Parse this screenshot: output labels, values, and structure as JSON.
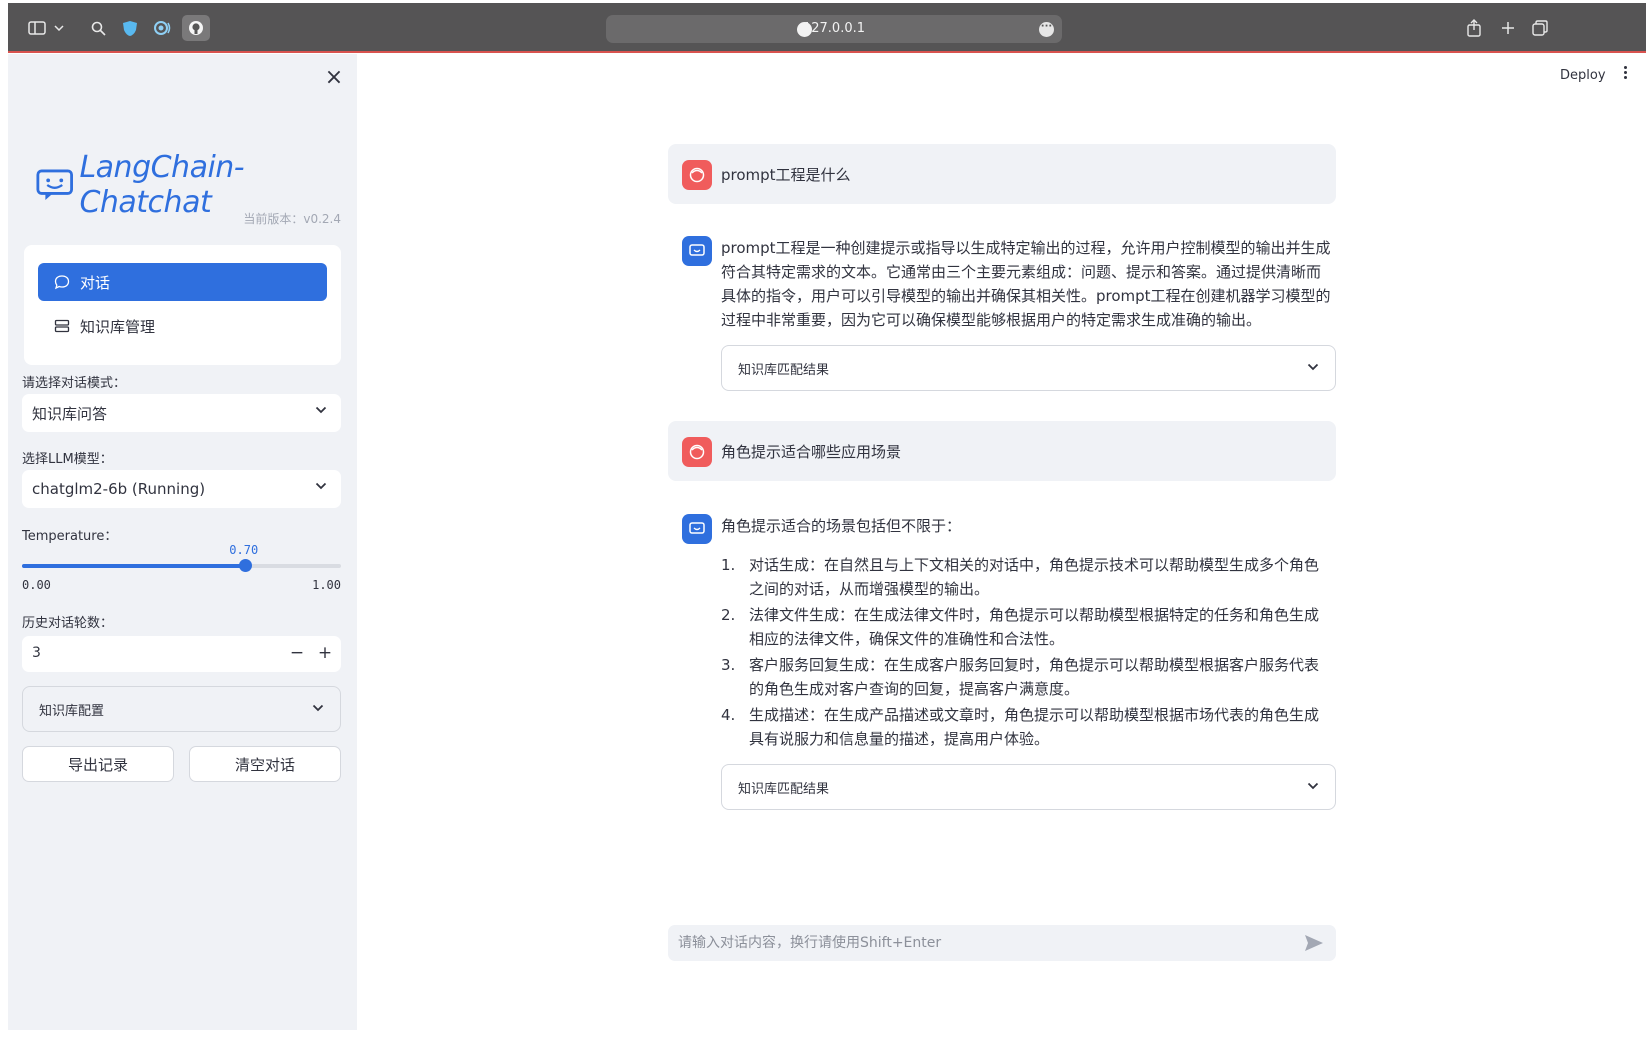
{
  "browser": {
    "address": "127.0.0.1",
    "icons": [
      "sidebar-toggle-icon",
      "chevron-down-icon",
      "search-icon",
      "shield-icon",
      "radio-icon",
      "github-icon",
      "share-icon",
      "plus-icon",
      "tabs-icon",
      "more-icon"
    ]
  },
  "sidebar": {
    "logo_text": "LangChain-Chatchat",
    "version": "当前版本：v0.2.4",
    "nav": [
      {
        "label": "对话",
        "icon": "chat-bubble-icon",
        "active": true
      },
      {
        "label": "知识库管理",
        "icon": "database-icon",
        "active": false
      }
    ],
    "mode_label": "请选择对话模式：",
    "mode_value": "知识库问答",
    "llm_label": "选择LLM模型：",
    "llm_value": "chatglm2-6b (Running)",
    "temperature_label": "Temperature：",
    "temperature_value": "0.70",
    "temperature_fraction": 0.7,
    "temperature_min": "0.00",
    "temperature_max": "1.00",
    "history_label": "历史对话轮数：",
    "history_value": "3",
    "stepper_minus": "−",
    "stepper_plus": "+",
    "kb_config_label": "知识库配置",
    "export_button": "导出记录",
    "clear_button": "清空对话"
  },
  "header": {
    "deploy_label": "Deploy"
  },
  "messages": [
    {
      "role": "user",
      "text": "prompt工程是什么"
    },
    {
      "role": "assistant",
      "text": "prompt工程是一种创建提示或指导以生成特定输出的过程，允许用户控制模型的输出并生成符合其特定需求的文本。它通常由三个主要元素组成：问题、提示和答案。通过提供清晰而具体的指令，用户可以引导模型的输出并确保其相关性。prompt工程在创建机器学习模型的过程中非常重要，因为它可以确保模型能够根据用户的特定需求生成准确的输出。",
      "kb_label": "知识库匹配结果"
    },
    {
      "role": "user",
      "text": "角色提示适合哪些应用场景"
    },
    {
      "role": "assistant",
      "intro": "角色提示适合的场景包括但不限于：",
      "items": [
        "对话生成：在自然且与上下文相关的对话中，角色提示技术可以帮助模型生成多个角色之间的对话，从而增强模型的输出。",
        "法律文件生成：在生成法律文件时，角色提示可以帮助模型根据特定的任务和角色生成相应的法律文件，确保文件的准确性和合法性。",
        "客户服务回复生成：在生成客户服务回复时，角色提示可以帮助模型根据客户服务代表的角色生成对客户查询的回复，提高客户满意度。",
        "生成描述：在生成产品描述或文章时，角色提示可以帮助模型根据市场代表的角色生成具有说服力和信息量的描述，提高用户体验。"
      ],
      "kb_label": "知识库匹配结果"
    }
  ],
  "chat_input": {
    "placeholder": "请输入对话内容，换行请使用Shift+Enter"
  },
  "colors": {
    "accent": "#2f6fde",
    "user_avatar": "#f05c5c",
    "sidebar_bg": "#f0f2f6"
  }
}
